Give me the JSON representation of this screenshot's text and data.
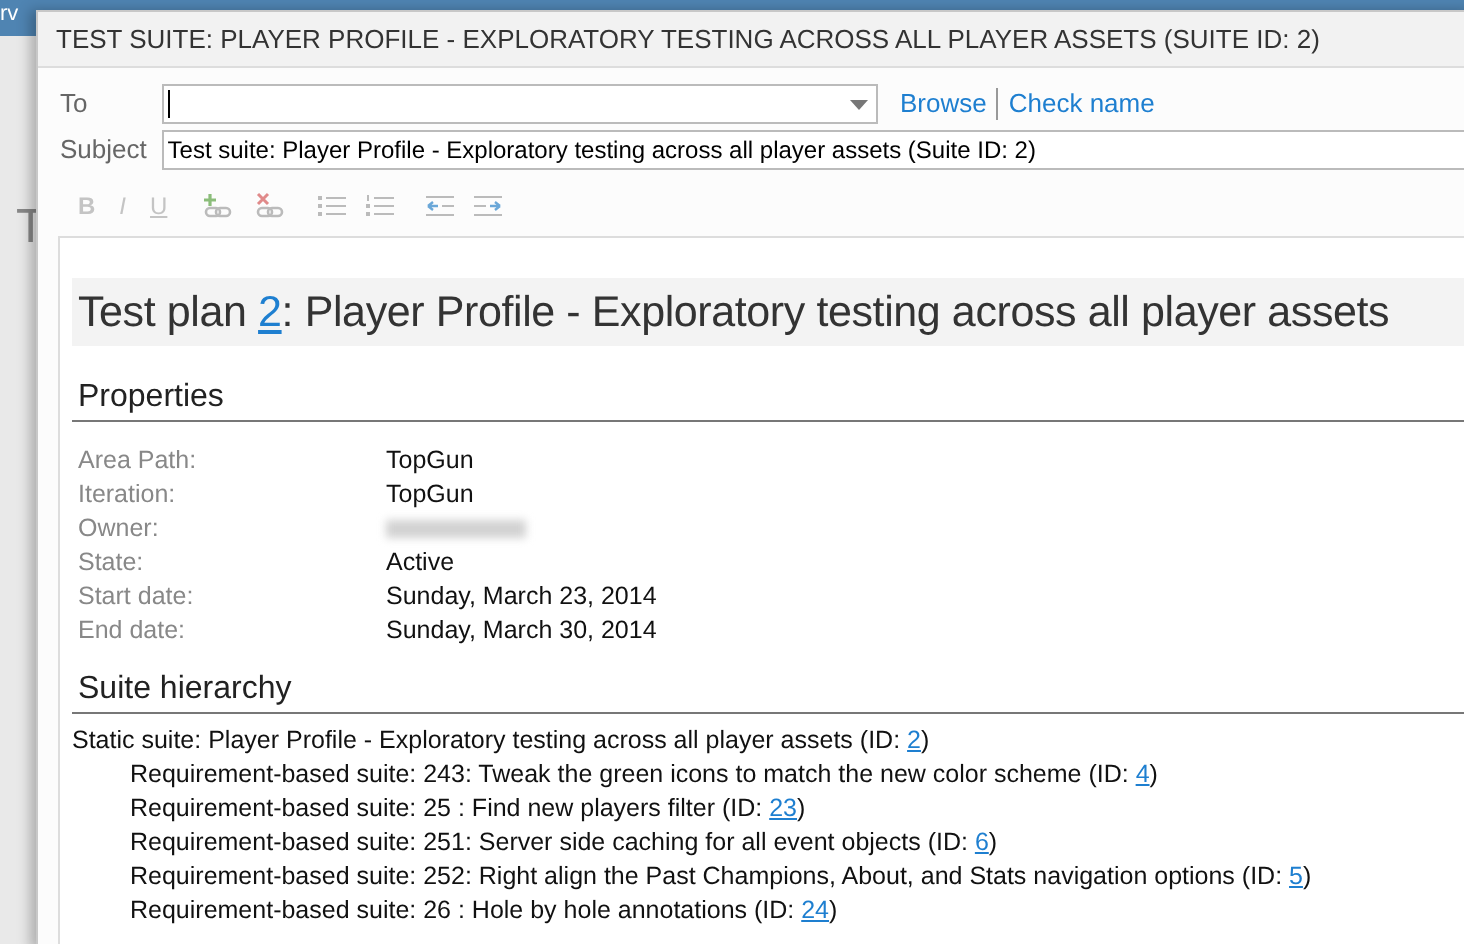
{
  "background_app": {
    "corner_text": "rv",
    "heading_letter": "T"
  },
  "window": {
    "title": "TEST SUITE: PLAYER PROFILE - EXPLORATORY TESTING ACROSS ALL PLAYER ASSETS (SUITE ID: 2)"
  },
  "to": {
    "label": "To",
    "links": [
      "Browse",
      "Check name"
    ]
  },
  "subject": {
    "label": "Subject",
    "value": "Test suite: Player Profile - Exploratory testing across all player assets (Suite ID: 2)"
  },
  "toolbar": [
    {
      "label": "B",
      "kind": "bold",
      "disabled": true
    },
    {
      "label": "I",
      "kind": "italic",
      "disabled": true
    },
    {
      "label": "U",
      "kind": "underline",
      "disabled": true
    }
  ],
  "body": {
    "title": {
      "before": "Test plan ",
      "link": "2",
      "after": ": Player Profile - Exploratory testing across all player assets"
    },
    "properties_heading": "Properties",
    "properties": [
      {
        "label": "Area Path:",
        "value": "TopGun"
      },
      {
        "label": "Iteration:",
        "value": "TopGun"
      },
      {
        "label": "Owner:",
        "redacted": true
      },
      {
        "label": "State:",
        "value": "Active"
      },
      {
        "label": "Start date:",
        "value": "Sunday, March 23, 2014"
      },
      {
        "label": "End date:",
        "value": "Sunday, March 30, 2014"
      }
    ],
    "hierarchy_heading": "Suite hierarchy",
    "suites": [
      {
        "text": "Static suite: Player Profile - Exploratory testing across all player assets (ID: ",
        "id": "2",
        "close": ")",
        "children": [
          {
            "text": "Requirement-based suite: 243: Tweak the green icons to match the new color scheme (ID: ",
            "id": "4",
            "close": ")"
          },
          {
            "text": "Requirement-based suite: 25 : Find new players filter (ID: ",
            "id": "23",
            "close": ")"
          },
          {
            "text": "Requirement-based suite: 251: Server side caching for all event objects (ID: ",
            "id": "6",
            "close": ")"
          },
          {
            "text": "Requirement-based suite: 252: Right align the Past Champions, About, and Stats navigation options (ID: ",
            "id": "5",
            "close": ")"
          },
          {
            "text": "Requirement-based suite: 26 : Hole by hole annotations (ID: ",
            "id": "24",
            "close": ")"
          }
        ]
      }
    ]
  }
}
